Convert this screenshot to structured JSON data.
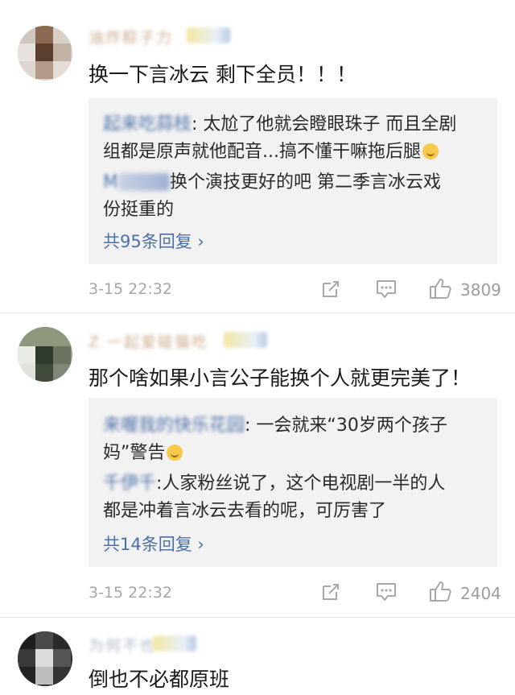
{
  "comments": [
    {
      "username": "油炸粽子力",
      "text": "换一下言冰云 剩下全员！！！",
      "replies": [
        {
          "name": "起来吃蒜枝",
          "text": ": 太尬了他就会瞪眼珠子 而且全剧"
        },
        {
          "name": "",
          "text": "组都是原声就他配音...搞不懂干嘛拖后腿"
        },
        {
          "name": "M",
          "text": "换个演技更好的吧 第二季言冰云戏"
        },
        {
          "name": "",
          "text": "份挺重的"
        }
      ],
      "more_replies": "共95条回复 ›",
      "timestamp": "3-15 22:32",
      "likes": "3809"
    },
    {
      "username": "Z 一起爱碰猫吃",
      "text": "那个啥如果小言公子能换个人就更完美了！",
      "replies": [
        {
          "name": "来喔我的快乐花园",
          "text": ": 一会就来“30岁两个孩子"
        },
        {
          "name": "",
          "text": "妈”警告"
        },
        {
          "name": "千伊千",
          "text": ":人家粉丝说了，这个电视剧一半的人"
        },
        {
          "name": "",
          "text": "都是冲着言冰云去看的呢，可厉害了"
        }
      ],
      "more_replies": "共14条回复 ›",
      "timestamp": "3-15 22:32",
      "likes": "2404"
    },
    {
      "username": "为何不也",
      "text": "倒也不必都原班"
    }
  ],
  "icons": {
    "share": "share-icon",
    "comment": "comment-icon",
    "like": "thumbs-up-icon"
  },
  "colors": {
    "link": "#4d70a8",
    "reply_bg": "#f2f2f2",
    "meta": "#a6a6a6"
  }
}
